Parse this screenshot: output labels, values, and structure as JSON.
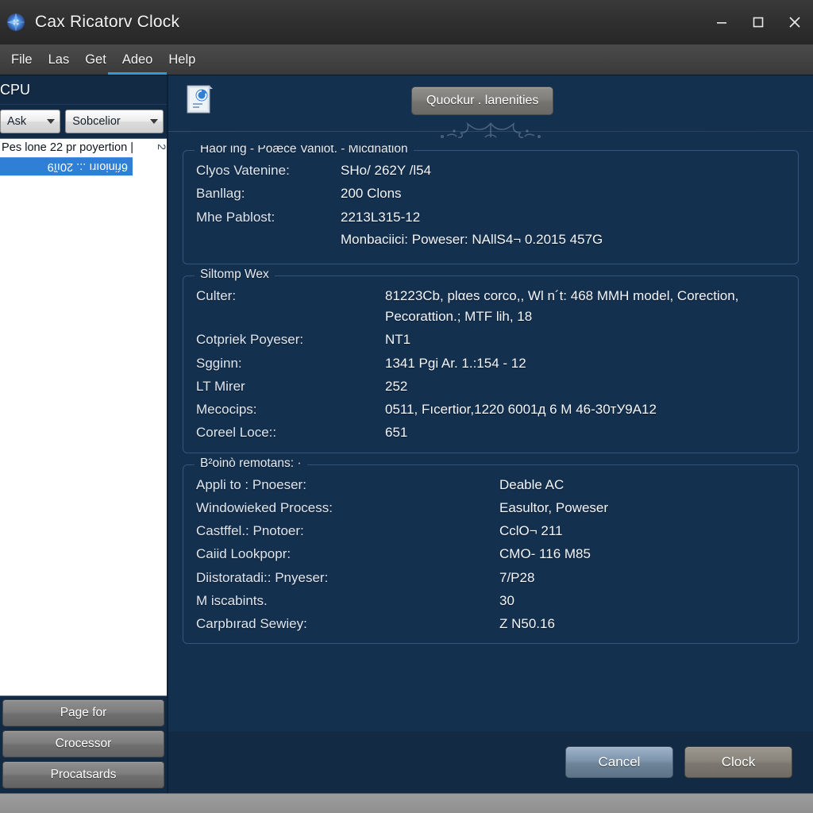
{
  "window": {
    "title": "Cax Ricatorv Clock",
    "app_icon": "app-logo-icon",
    "minimize": "minimize-icon",
    "maximize": "maximize-icon",
    "close": "close-icon"
  },
  "menubar": {
    "items": [
      {
        "label": "File"
      },
      {
        "label": "Las"
      },
      {
        "label": "Get"
      },
      {
        "label": "Adeo"
      },
      {
        "label": "Help"
      }
    ]
  },
  "sidebar": {
    "header": "CPU",
    "selects": [
      {
        "name": "filter-select",
        "value": "Ask"
      },
      {
        "name": "category-select",
        "value": "Sobcelior"
      }
    ],
    "list": [
      {
        "label": "Pes lone 22 pr poyertion |",
        "selected": false
      },
      {
        "label": "6ŕinioırı .:.  20ıȉ9",
        "selected": true
      }
    ],
    "scroll_mark": "2",
    "buttons": [
      {
        "label": "Page for"
      },
      {
        "label": "Crocessor"
      },
      {
        "label": "Procatsards"
      }
    ]
  },
  "main": {
    "doc_icon": "document-icon",
    "quick_button": "Quockur . lanenities",
    "ornament": "flourish-ornament",
    "groups": [
      {
        "name": "group-hardware",
        "title": "Haor ing - Poæce Vaniot. - Micdnation",
        "rows": [
          {
            "label": "Clyos Vatenine:",
            "value": "SHo/ 262Y /l54"
          },
          {
            "label": "Banllag:",
            "value": "200 Clons"
          },
          {
            "label": "Mhe Pablost:",
            "value": "2213L315-12"
          }
        ],
        "extra_value": "Monbaciici: Poweser: NAllS4¬ 0.2015 457G"
      },
      {
        "name": "group-silomp",
        "title": "Siltomp Wex",
        "rows": [
          {
            "label": "Culter:",
            "value": "81223Сb, plαes corco,, Wl n´t: 468 MMH model, Corection,",
            "value2": "Pecorattion.; MTF lih, 18"
          },
          {
            "label": "Cotpriek Poyeser:",
            "value": "NT1"
          },
          {
            "label": "Sgginn:",
            "value": "1341 Pgi Ar. 1.:154 - 12"
          },
          {
            "label": "LT Mirer",
            "value": "252"
          },
          {
            "label": "Mecocips:",
            "value": "0511, Fıcertior,1220 6001д 6 M 46-30тУ9A12"
          },
          {
            "label": "Coreel Loce::",
            "value": "651"
          }
        ]
      },
      {
        "name": "group-boind",
        "title": "B²oinò rеmotans: ·",
        "rows": [
          {
            "label": "Appli to : Pnoeser:",
            "value": "Deable AC"
          },
          {
            "label": "Windowieked Process:",
            "value": "Easultor, Poweser"
          },
          {
            "label": "Castffel.: Pnotoer:",
            "value": "CclO¬ 211"
          },
          {
            "label": "Caiid Lookpopr:",
            "value": "CMO- 116 M85"
          },
          {
            "label": "Diistoratadi:: Pnyeser:",
            "value": "7/P28"
          },
          {
            "label": "M iscabints.",
            "value": "30"
          },
          {
            "label": "Carpbırad Sewiey:",
            "value": "Z N50.16"
          }
        ]
      }
    ]
  },
  "footer": {
    "cancel_label": "Cancel",
    "ok_label": "Clock"
  },
  "colors": {
    "window_bg": "#14304f",
    "sidebar_bg": "#132a45",
    "titlebar_bg": "#2e2e2e",
    "accent": "#2f9ae0",
    "selection": "#2f7fd6",
    "group_border": "#31557c"
  }
}
